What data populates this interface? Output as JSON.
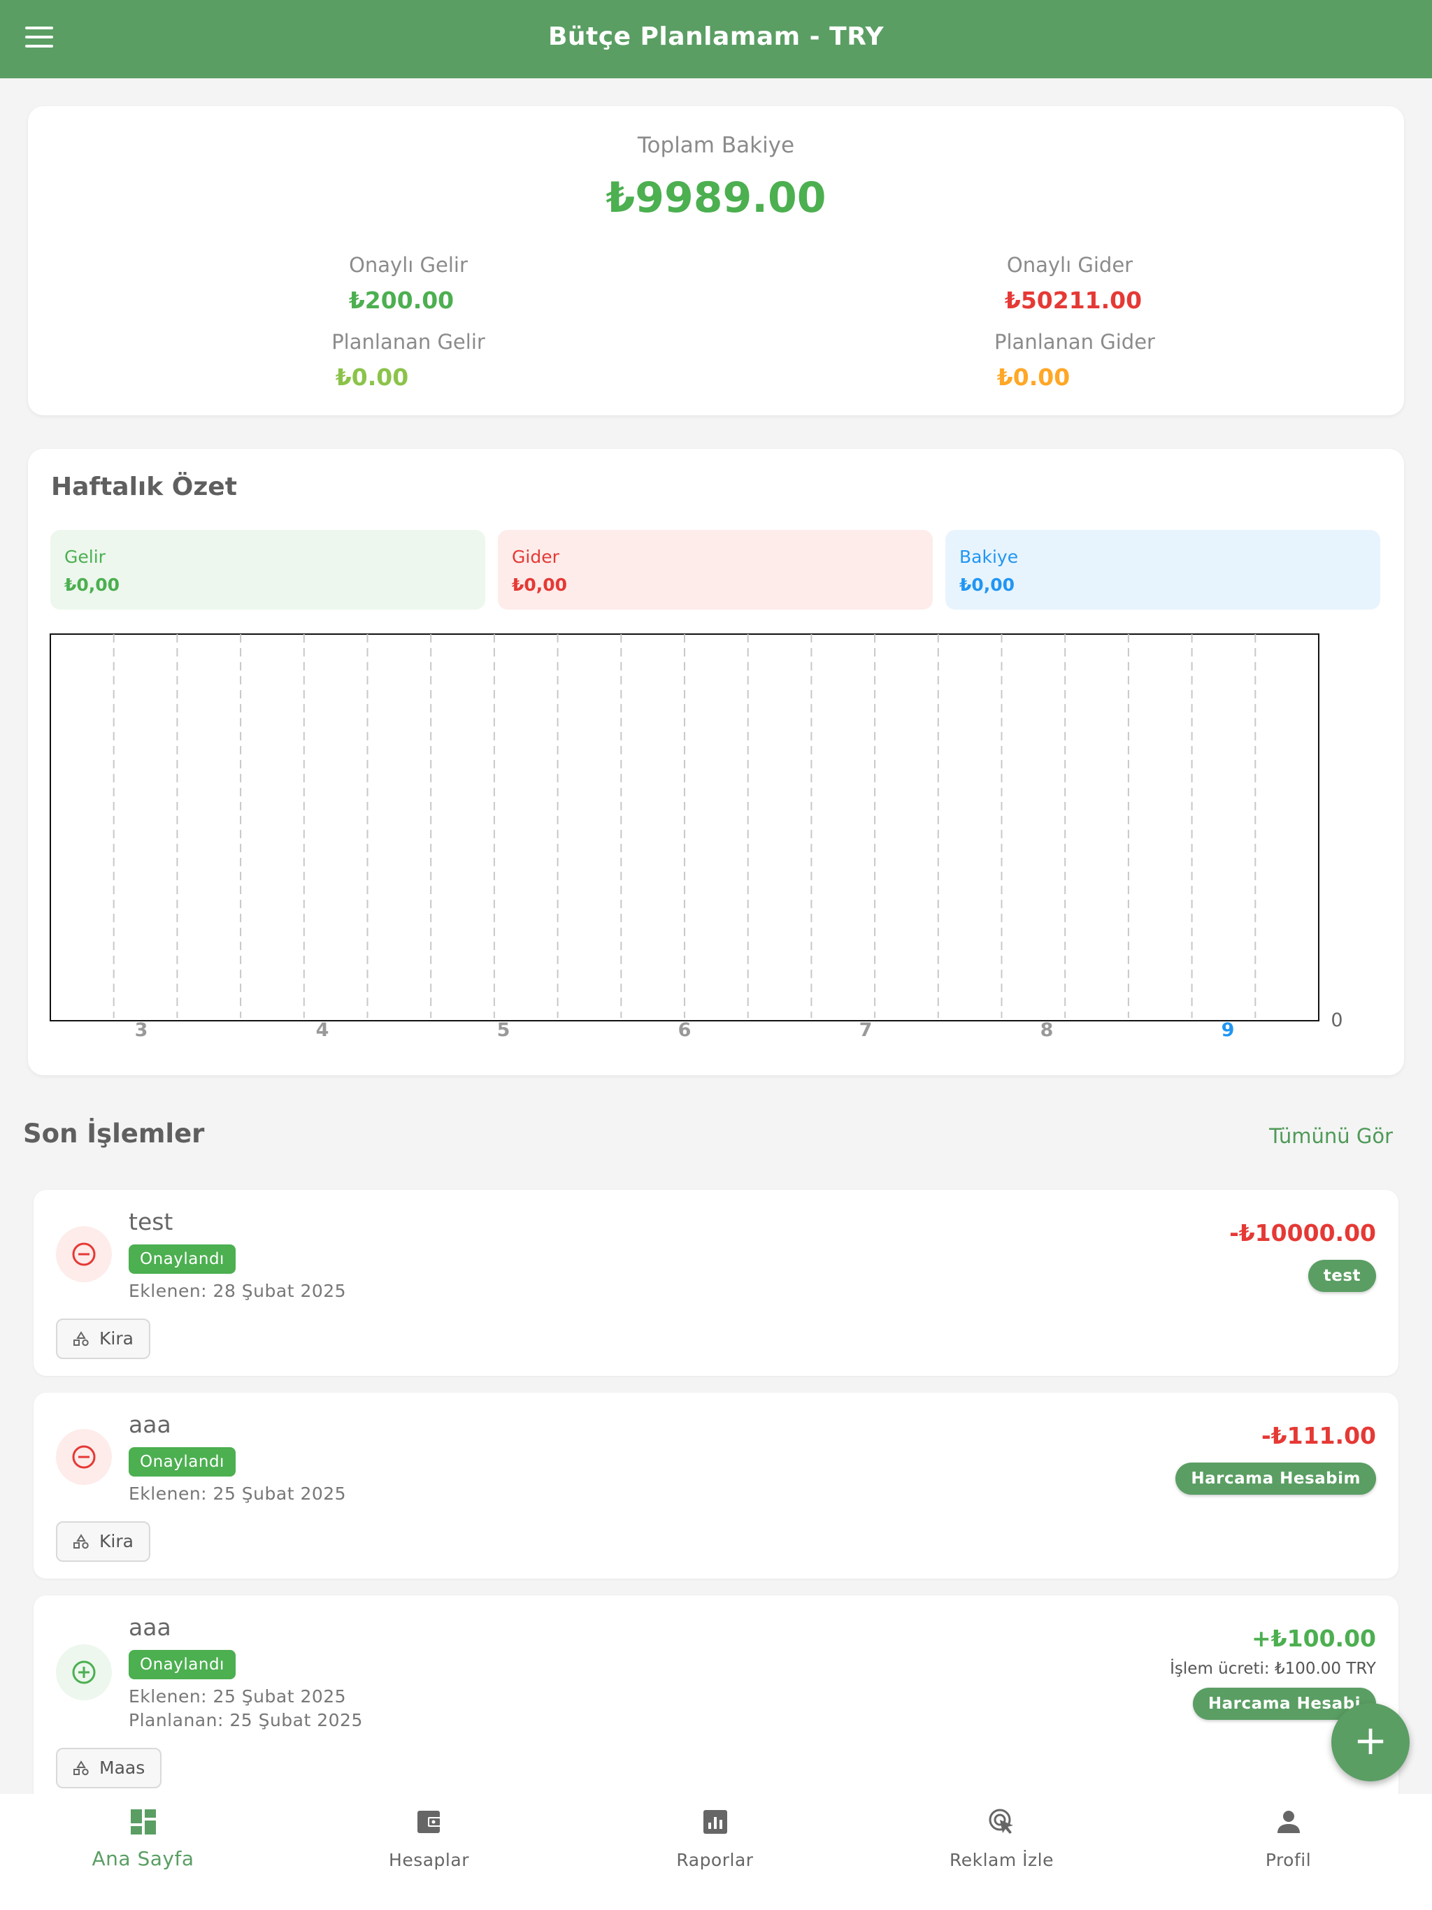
{
  "header": {
    "title": "Bütçe Planlamam - TRY"
  },
  "summary": {
    "total_label": "Toplam Bakiye",
    "total_value": "₺9989.00",
    "approved_income_label": "Onaylı Gelir",
    "approved_income_value": "₺200.00",
    "approved_expense_label": "Onaylı Gider",
    "approved_expense_value": "₺50211.00",
    "planned_income_label": "Planlanan Gelir",
    "planned_income_value": "₺0.00",
    "planned_expense_label": "Planlanan Gider",
    "planned_expense_value": "₺0.00"
  },
  "weekly": {
    "title": "Haftalık Özet",
    "income_label": "Gelir",
    "income_value": "₺0,00",
    "expense_label": "Gider",
    "expense_value": "₺0,00",
    "balance_label": "Bakiye",
    "balance_value": "₺0,00"
  },
  "chart_data": {
    "type": "bar",
    "categories": [
      "3",
      "4",
      "5",
      "6",
      "7",
      "8",
      "9"
    ],
    "highlighted_category": "9",
    "values": [
      0,
      0,
      0,
      0,
      0,
      0,
      0
    ],
    "y_tick_labels": [
      "0"
    ],
    "ylim": [
      0,
      0
    ],
    "grid": "vertical dashed",
    "colors": {
      "highlight_tick": "#2196f3",
      "tick": "#999999"
    }
  },
  "recent": {
    "title": "Son İşlemler",
    "see_all": "Tümünü Gör",
    "transactions": [
      {
        "name": "test",
        "status": "Onaylandı",
        "added": "Eklenen: 28 Şubat 2025",
        "category": "Kira",
        "amount": "-₺10000.00",
        "account": "test",
        "kind": "expense"
      },
      {
        "name": "aaa",
        "status": "Onaylandı",
        "added": "Eklenen: 25 Şubat 2025",
        "category": "Kira",
        "amount": "-₺111.00",
        "account": "Harcama Hesabim",
        "kind": "expense"
      },
      {
        "name": "aaa",
        "status": "Onaylandı",
        "added": "Eklenen: 25 Şubat 2025",
        "planned": "Planlanan: 25 Şubat 2025",
        "category": "Maas",
        "amount": "+₺100.00",
        "fee": "İşlem ücreti: ₺100.00 TRY",
        "account": "Harcama Hesabi",
        "kind": "income"
      }
    ]
  },
  "fab": {
    "label": "+"
  },
  "nav": {
    "items": [
      {
        "label": "Ana Sayfa",
        "icon": "dashboard-icon",
        "active": true
      },
      {
        "label": "Hesaplar",
        "icon": "wallet-icon"
      },
      {
        "label": "Raporlar",
        "icon": "chart-icon"
      },
      {
        "label": "Reklam İzle",
        "icon": "ad-click-icon"
      },
      {
        "label": "Profil",
        "icon": "person-icon"
      }
    ]
  },
  "colors": {
    "primary": "#5a9e63",
    "income": "#4caf50",
    "expense": "#e53935",
    "planned_income": "#8bc34a",
    "planned_expense": "#ffa726",
    "balance": "#2196f3",
    "badge": "#4caf50"
  }
}
